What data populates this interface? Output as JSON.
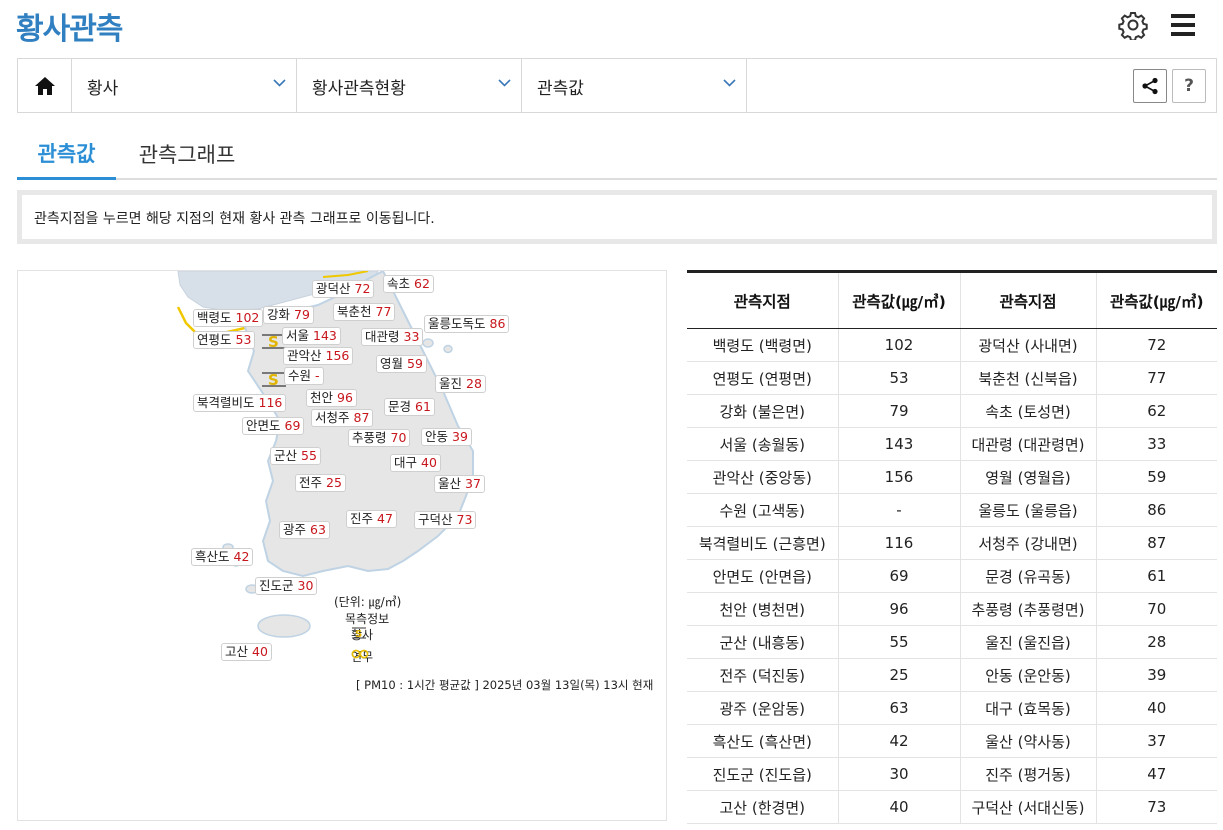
{
  "header": {
    "title": "황사관측",
    "settings_icon": "gear-icon",
    "menu_icon": "hamburger-menu-icon"
  },
  "nav": {
    "home_icon": "home-icon",
    "dropdowns": [
      "황사",
      "황사관측현황",
      "관측값"
    ],
    "share_icon": "share-icon",
    "help_label": "?"
  },
  "tabs": [
    "관측값",
    "관측그래프"
  ],
  "notice": "관측지점을 누르면 해당 지점의 현재 황사 관측 그래프로 이동됩니다.",
  "map": {
    "stations": [
      {
        "name": "광덕산",
        "value": "72"
      },
      {
        "name": "속초",
        "value": "62"
      },
      {
        "name": "백령도",
        "value": "102"
      },
      {
        "name": "강화",
        "value": "79"
      },
      {
        "name": "북춘천",
        "value": "77"
      },
      {
        "name": "울릉도독도",
        "value": "86"
      },
      {
        "name": "연평도",
        "value": "53"
      },
      {
        "name": "서울",
        "value": "143"
      },
      {
        "name": "대관령",
        "value": "33"
      },
      {
        "name": "관악산",
        "value": "156"
      },
      {
        "name": "영월",
        "value": "59"
      },
      {
        "name": "수원",
        "value": "-"
      },
      {
        "name": "울진",
        "value": "28"
      },
      {
        "name": "북격렬비도",
        "value": "116"
      },
      {
        "name": "천안",
        "value": "96"
      },
      {
        "name": "문경",
        "value": "61"
      },
      {
        "name": "서청주",
        "value": "87"
      },
      {
        "name": "안면도",
        "value": "69"
      },
      {
        "name": "추풍령",
        "value": "70"
      },
      {
        "name": "안동",
        "value": "39"
      },
      {
        "name": "군산",
        "value": "55"
      },
      {
        "name": "대구",
        "value": "40"
      },
      {
        "name": "전주",
        "value": "25"
      },
      {
        "name": "울산",
        "value": "37"
      },
      {
        "name": "진주",
        "value": "47"
      },
      {
        "name": "구덕산",
        "value": "73"
      },
      {
        "name": "광주",
        "value": "63"
      },
      {
        "name": "흑산도",
        "value": "42"
      },
      {
        "name": "진도군",
        "value": "30"
      },
      {
        "name": "고산",
        "value": "40"
      }
    ],
    "unit": "(단위: ㎍/㎥)",
    "legend_title": "목측정보",
    "legend_items": [
      "황사",
      "연무"
    ],
    "footnote": "[ PM10 : 1시간 평균값 ] 2025년 03월 13일(목) 13시 현재",
    "colors": {
      "dust": "#e0b400",
      "haze": "#e8c000",
      "value": "#c8161d",
      "land": "#e6e6e6",
      "sea_coast": "#c8daea"
    }
  },
  "table": {
    "headers": [
      "관측지점",
      "관측값(㎍/㎥)",
      "관측지점",
      "관측값(㎍/㎥)"
    ],
    "rows": [
      [
        "백령도 (백령면)",
        "102",
        "광덕산 (사내면)",
        "72"
      ],
      [
        "연평도 (연평면)",
        "53",
        "북춘천 (신북읍)",
        "77"
      ],
      [
        "강화 (불은면)",
        "79",
        "속초 (토성면)",
        "62"
      ],
      [
        "서울 (송월동)",
        "143",
        "대관령 (대관령면)",
        "33"
      ],
      [
        "관악산 (중앙동)",
        "156",
        "영월 (영월읍)",
        "59"
      ],
      [
        "수원 (고색동)",
        "-",
        "울릉도 (울릉읍)",
        "86"
      ],
      [
        "북격렬비도 (근흥면)",
        "116",
        "서청주 (강내면)",
        "87"
      ],
      [
        "안면도 (안면읍)",
        "69",
        "문경 (유곡동)",
        "61"
      ],
      [
        "천안 (병천면)",
        "96",
        "추풍령 (추풍령면)",
        "70"
      ],
      [
        "군산 (내흥동)",
        "55",
        "울진 (울진읍)",
        "28"
      ],
      [
        "전주 (덕진동)",
        "25",
        "안동 (운안동)",
        "39"
      ],
      [
        "광주 (운암동)",
        "63",
        "대구 (효목동)",
        "40"
      ],
      [
        "흑산도 (흑산면)",
        "42",
        "울산 (약사동)",
        "37"
      ],
      [
        "진도군 (진도읍)",
        "30",
        "진주 (평거동)",
        "47"
      ],
      [
        "고산 (한경면)",
        "40",
        "구덕산 (서대신동)",
        "73"
      ]
    ]
  }
}
